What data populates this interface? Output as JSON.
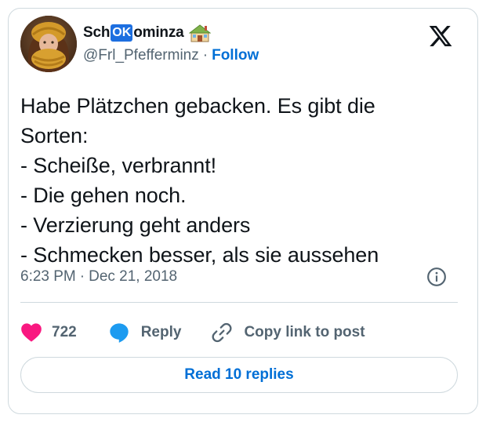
{
  "author": {
    "name_prefix": "Sch",
    "name_badge": "OK",
    "name_suffix": "ominza",
    "house_icon": "house-emoji-icon",
    "handle": "@Frl_Pfefferminz",
    "separator": "·",
    "follow_label": "Follow"
  },
  "tweet": {
    "text": "Habe Plätzchen gebacken. Es gibt die\nSorten:\n- Scheiße, verbrannt!\n- Die gehen noch.\n- Verzierung geht anders\n- Schmecken besser, als sie aussehen",
    "time": "6:23 PM",
    "separator": "·",
    "date": "Dec 21, 2018"
  },
  "actions": {
    "likes_count": "722",
    "reply_label": "Reply",
    "copy_label": "Copy link to post"
  },
  "read_replies_label": "Read 10 replies",
  "colors": {
    "like": "#f91880",
    "reply": "#1d9bf0",
    "link": "#006fd6",
    "muted": "#536471",
    "border": "#cfd9de",
    "ok_badge": "#1d6fe0"
  }
}
